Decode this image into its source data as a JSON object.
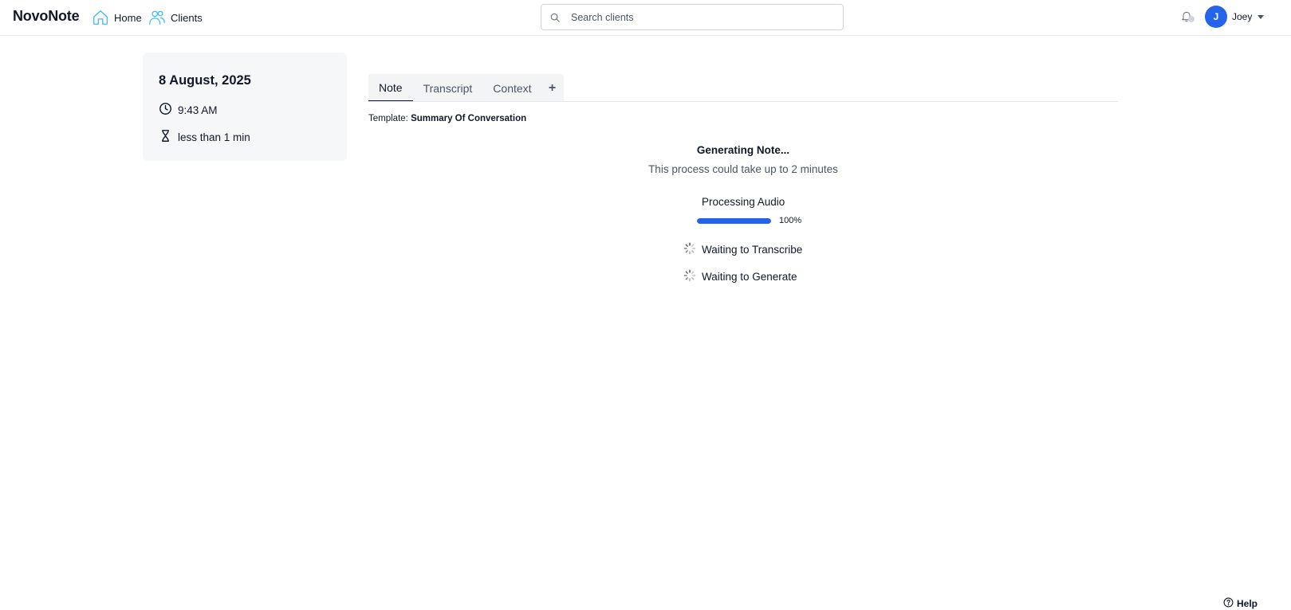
{
  "app": {
    "brand": "NovoNote"
  },
  "nav": {
    "home_label": "Home",
    "clients_label": "Clients"
  },
  "search": {
    "placeholder": "Search clients",
    "value": ""
  },
  "user": {
    "initial": "J",
    "name": "Joey"
  },
  "session": {
    "date": "8 August, 2025",
    "time": "9:43 AM",
    "duration": "less than 1 min"
  },
  "tabs": [
    {
      "label": "Note",
      "active": true
    },
    {
      "label": "Transcript",
      "active": false
    },
    {
      "label": "Context",
      "active": false
    }
  ],
  "tab_add_label": "+",
  "template": {
    "prefix": "Template:",
    "name": "Summary Of Conversation"
  },
  "generation": {
    "title": "Generating Note...",
    "subtitle": "This process could take up to 2 minutes",
    "steps": [
      {
        "label": "Processing Audio",
        "progress": 1.0,
        "progress_text": "100%"
      },
      {
        "label": "Waiting to Transcribe",
        "status": "waiting"
      },
      {
        "label": "Waiting to Generate",
        "status": "waiting"
      }
    ]
  },
  "help": {
    "label": "Help"
  },
  "colors": {
    "accent": "#2563eb",
    "nav_icon": "#38bdf8",
    "card_bg": "#f6f7f9"
  }
}
